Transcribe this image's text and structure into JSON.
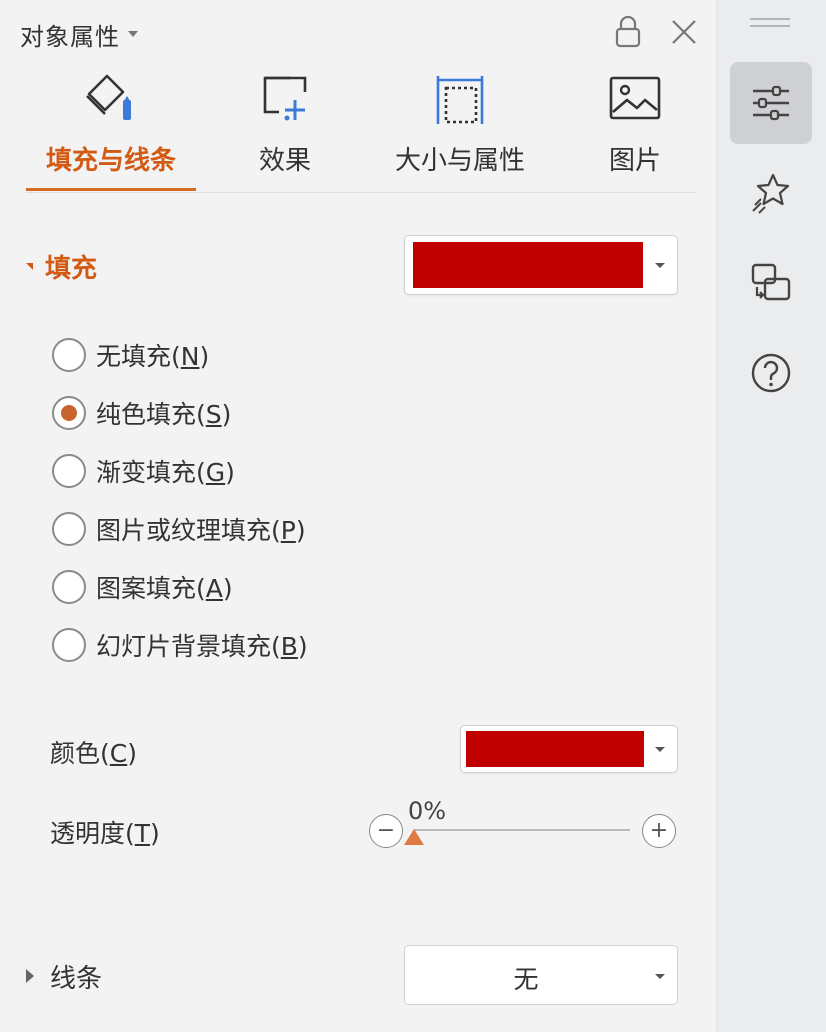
{
  "header": {
    "title": "对象属性",
    "lock_icon": "lock-icon",
    "close_icon": "close-icon"
  },
  "tabs": [
    {
      "label": "填充与线条",
      "icon": "fill-bucket-icon",
      "active": true
    },
    {
      "label": "效果",
      "icon": "effects-icon",
      "active": false
    },
    {
      "label": "大小与属性",
      "icon": "size-icon",
      "active": false
    },
    {
      "label": "图片",
      "icon": "picture-icon",
      "active": false
    }
  ],
  "fill": {
    "label": "填充",
    "swatch_color": "#c00000",
    "options": [
      {
        "text": "无填充(",
        "key": "N",
        "end": ")",
        "checked": false
      },
      {
        "text": "纯色填充(",
        "key": "S",
        "end": ")",
        "checked": true
      },
      {
        "text": "渐变填充(",
        "key": "G",
        "end": ")",
        "checked": false
      },
      {
        "text": "图片或纹理填充(",
        "key": "P",
        "end": ")",
        "checked": false
      },
      {
        "text": "图案填充(",
        "key": "A",
        "end": ")",
        "checked": false
      },
      {
        "text": "幻灯片背景填充(",
        "key": "B",
        "end": ")",
        "checked": false
      }
    ]
  },
  "color": {
    "label_text": "颜色(",
    "label_key": "C",
    "label_end": ")",
    "swatch_color": "#c00000"
  },
  "transparency": {
    "label_text": "透明度(",
    "label_key": "T",
    "label_end": ")",
    "value_text": "0%",
    "value_percent": 0,
    "minus": "−",
    "plus": "+"
  },
  "line": {
    "label": "线条",
    "value": "无"
  },
  "rail": {
    "buttons": [
      {
        "icon": "property-sliders-icon",
        "active": true
      },
      {
        "icon": "star-animation-icon",
        "active": false
      },
      {
        "icon": "switch-slides-icon",
        "active": false
      },
      {
        "icon": "help-icon",
        "active": false
      }
    ]
  },
  "colors": {
    "accent": "#d35a12",
    "red_swatch": "#c00000"
  }
}
